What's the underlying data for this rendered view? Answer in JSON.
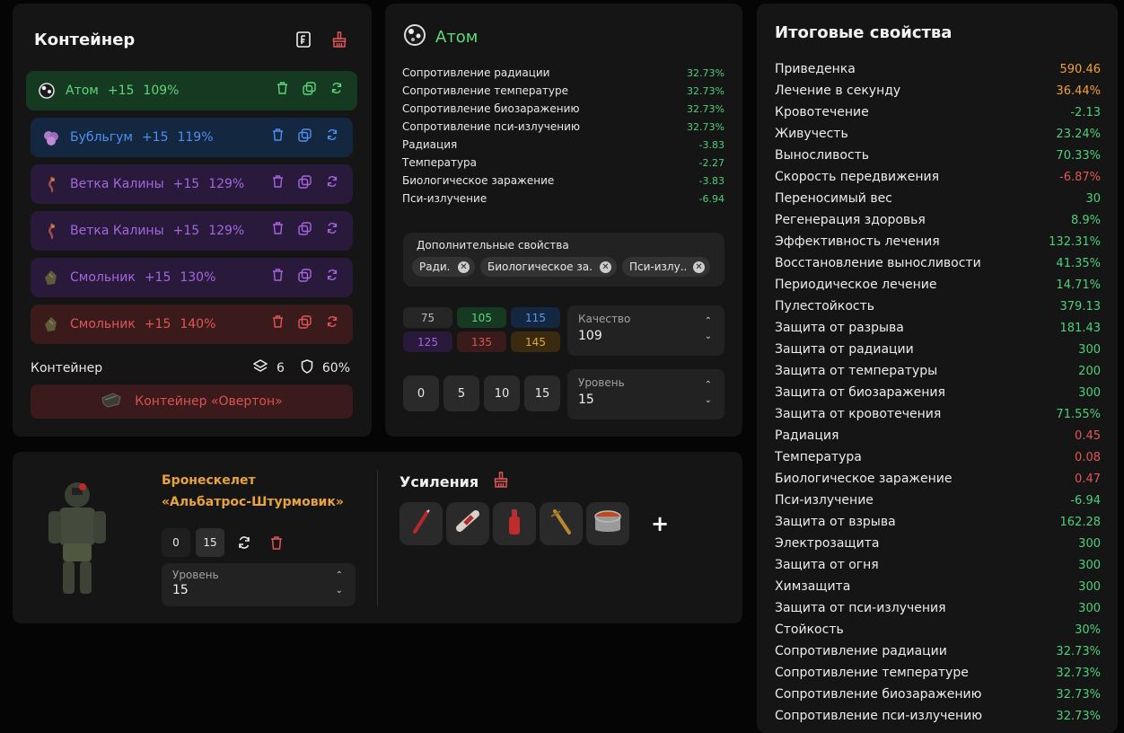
{
  "colors": {
    "green": "#4ed07a",
    "red": "#e05656",
    "orange": "#f0a13a"
  },
  "container": {
    "title": "Контейнер",
    "artifacts": [
      {
        "name": "Атом",
        "level": "+15",
        "percent": "109%",
        "color": "#5cd67c",
        "bg": "#163a21",
        "icon": "atom-icon"
      },
      {
        "name": "Бубльгум",
        "level": "+15",
        "percent": "119%",
        "color": "#4f8ff0",
        "bg": "#132741",
        "icon": "bubblegum-icon"
      },
      {
        "name": "Ветка Калины",
        "level": "+15",
        "percent": "129%",
        "color": "#a466de",
        "bg": "#29193a",
        "icon": "viburnum-icon"
      },
      {
        "name": "Ветка Калины",
        "level": "+15",
        "percent": "129%",
        "color": "#a466de",
        "bg": "#29193a",
        "icon": "viburnum-icon"
      },
      {
        "name": "Смольник",
        "level": "+15",
        "percent": "130%",
        "color": "#a466de",
        "bg": "#29193a",
        "icon": "resin-icon"
      },
      {
        "name": "Смольник",
        "level": "+15",
        "percent": "140%",
        "color": "#e05656",
        "bg": "#3b1a1b",
        "icon": "resin-icon"
      }
    ],
    "footer": {
      "label": "Контейнер",
      "slots": "6",
      "protection": "60%"
    },
    "container_button": "Контейнер «Овертон»"
  },
  "atom": {
    "title": "Атом",
    "stats": [
      {
        "label": "Сопротивление радиации",
        "value": "32.73%",
        "tone": "green"
      },
      {
        "label": "Сопротивление температуре",
        "value": "32.73%",
        "tone": "green"
      },
      {
        "label": "Сопротивление биозаражению",
        "value": "32.73%",
        "tone": "green"
      },
      {
        "label": "Сопротивление пси-излучению",
        "value": "32.73%",
        "tone": "green"
      },
      {
        "label": "Радиация",
        "value": "-3.83",
        "tone": "green"
      },
      {
        "label": "Температура",
        "value": "-2.27",
        "tone": "green"
      },
      {
        "label": "Биологическое заражение",
        "value": "-3.83",
        "tone": "green"
      },
      {
        "label": "Пси-излучение",
        "value": "-6.94",
        "tone": "green"
      }
    ],
    "extra_title": "Дополнительные свойства",
    "chips": [
      "Ради...",
      "Биологическое за...",
      "Пси-излу..."
    ],
    "quality_cells": [
      {
        "v": "75",
        "bg": "#262626",
        "fg": "#bbbbbb"
      },
      {
        "v": "105",
        "bg": "#163a21",
        "fg": "#5cd67c"
      },
      {
        "v": "115",
        "bg": "#132741",
        "fg": "#5d95ef"
      },
      {
        "v": "125",
        "bg": "#29193a",
        "fg": "#a466de"
      },
      {
        "v": "135",
        "bg": "#3b1a1b",
        "fg": "#d25a55"
      },
      {
        "v": "145",
        "bg": "#3a2a10",
        "fg": "#e8a33d"
      }
    ],
    "quality": {
      "label": "Качество",
      "value": "109"
    },
    "level_buttons": [
      "0",
      "5",
      "10",
      "15"
    ],
    "level": {
      "label": "Уровень",
      "value": "15"
    }
  },
  "armor": {
    "name_line1": "Бронескелет",
    "name_line2": "«Альбатрос-Штурмовик»",
    "buttons": [
      "0",
      "15"
    ],
    "level": {
      "label": "Уровень",
      "value": "15"
    },
    "boosts_title": "Усиления",
    "plus": "+"
  },
  "totals": {
    "title": "Итоговые свойства",
    "rows": [
      {
        "label": "Приведенка",
        "value": "590.46",
        "tone": "orange"
      },
      {
        "label": "Лечение в секунду",
        "value": "36.44%",
        "tone": "orange"
      },
      {
        "label": "Кровотечение",
        "value": "-2.13",
        "tone": "green"
      },
      {
        "label": "Живучесть",
        "value": "23.24%",
        "tone": "green"
      },
      {
        "label": "Выносливость",
        "value": "70.33%",
        "tone": "green"
      },
      {
        "label": "Скорость передвижения",
        "value": "-6.87%",
        "tone": "red"
      },
      {
        "label": "Переносимый вес",
        "value": "30",
        "tone": "green"
      },
      {
        "label": "Регенерация здоровья",
        "value": "8.9%",
        "tone": "green"
      },
      {
        "label": "Эффективность лечения",
        "value": "132.31%",
        "tone": "green"
      },
      {
        "label": "Восстановление выносливости",
        "value": "41.35%",
        "tone": "green"
      },
      {
        "label": "Периодическое лечение",
        "value": "14.71%",
        "tone": "green"
      },
      {
        "label": "Пулестойкость",
        "value": "379.13",
        "tone": "green"
      },
      {
        "label": "Защита от разрыва",
        "value": "181.43",
        "tone": "green"
      },
      {
        "label": "Защита от радиации",
        "value": "300",
        "tone": "green"
      },
      {
        "label": "Защита от температуры",
        "value": "200",
        "tone": "green"
      },
      {
        "label": "Защита от биозаражения",
        "value": "300",
        "tone": "green"
      },
      {
        "label": "Защита от кровотечения",
        "value": "71.55%",
        "tone": "green"
      },
      {
        "label": "Радиация",
        "value": "0.45",
        "tone": "red"
      },
      {
        "label": "Температура",
        "value": "0.08",
        "tone": "red"
      },
      {
        "label": "Биологическое заражение",
        "value": "0.47",
        "tone": "red"
      },
      {
        "label": "Пси-излучение",
        "value": "-6.94",
        "tone": "green"
      },
      {
        "label": "Защита от взрыва",
        "value": "162.28",
        "tone": "green"
      },
      {
        "label": "Электрозащита",
        "value": "300",
        "tone": "green"
      },
      {
        "label": "Защита от огня",
        "value": "300",
        "tone": "green"
      },
      {
        "label": "Химзащита",
        "value": "300",
        "tone": "green"
      },
      {
        "label": "Защита от пси-излучения",
        "value": "300",
        "tone": "green"
      },
      {
        "label": "Стойкость",
        "value": "30%",
        "tone": "green"
      },
      {
        "label": "Сопротивление радиации",
        "value": "32.73%",
        "tone": "green"
      },
      {
        "label": "Сопротивление температуре",
        "value": "32.73%",
        "tone": "green"
      },
      {
        "label": "Сопротивление биозаражению",
        "value": "32.73%",
        "tone": "green"
      },
      {
        "label": "Сопротивление пси-излучению",
        "value": "32.73%",
        "tone": "green"
      }
    ]
  }
}
